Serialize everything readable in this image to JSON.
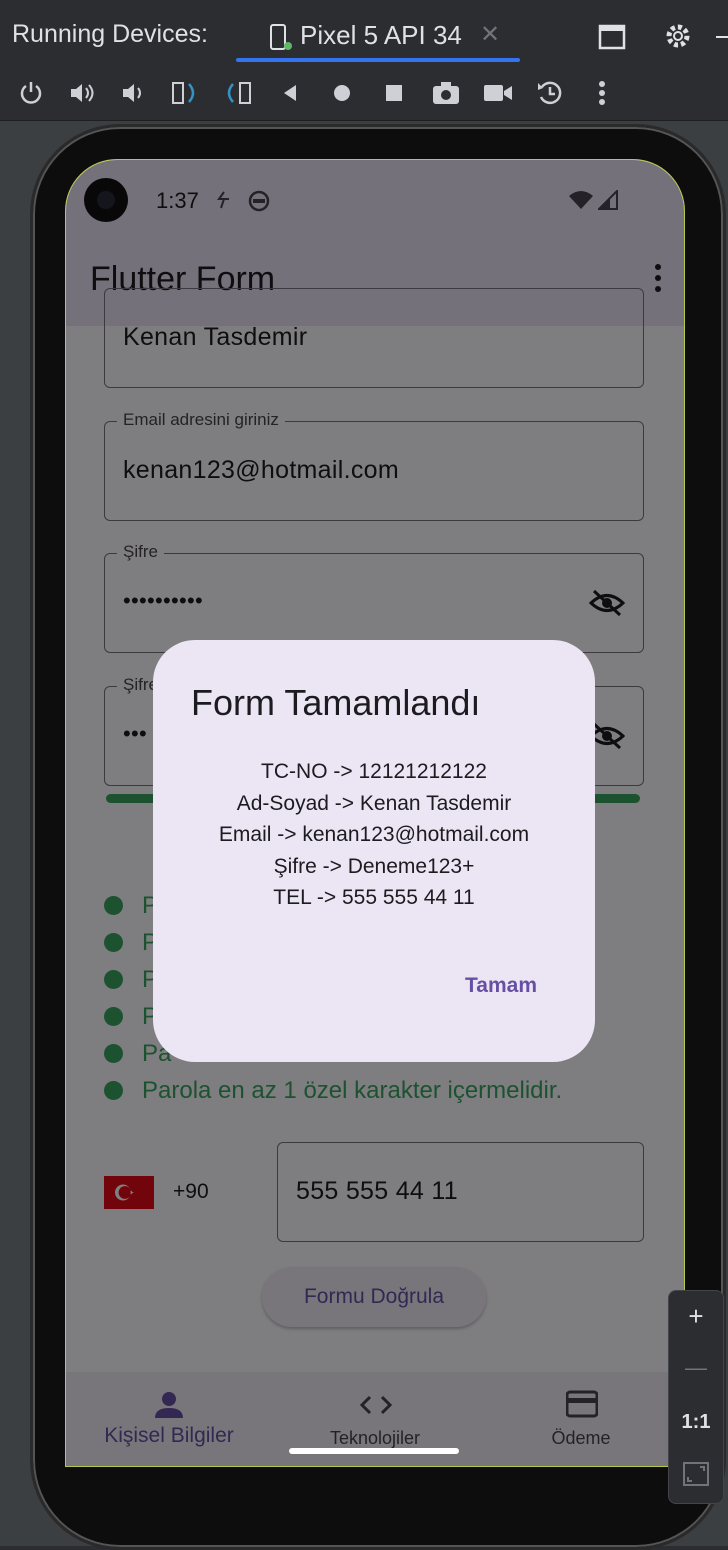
{
  "ide": {
    "panel_title": "Running Devices:",
    "device_tab": "Pixel 5 API 34",
    "toolbar_icons": [
      "power-icon",
      "volume-up-icon",
      "volume-down-icon",
      "rotate-left-icon",
      "rotate-right-icon",
      "back-icon",
      "home-icon",
      "overview-icon",
      "screenshot-icon",
      "screen-record-icon",
      "snapshot-icon",
      "more-icon"
    ],
    "zoom": {
      "plus": "+",
      "minus": "—",
      "one_to_one": "1:1"
    }
  },
  "status_bar": {
    "time": "1:37"
  },
  "app_bar": {
    "title": "Flutter Form"
  },
  "form": {
    "name_value": "Kenan Tasdemir",
    "email_label": "Email adresini giriniz",
    "email_value": "kenan123@hotmail.com",
    "password_label": "Şifre",
    "password_value": "••••••••••",
    "password_confirm_label": "Şifre",
    "password_confirm_value": "•••",
    "last_rule": "Parola en az 1 özel karakter içermelidir.",
    "rule_prefix_1": "P",
    "rule_prefix_2": "P",
    "rule_prefix_3": "P",
    "rule_prefix_4": "P",
    "rule_prefix_5": "Pa",
    "country_code": "+90",
    "phone_value": "555 555 44 11",
    "submit_label": "Formu Doğrula",
    "password_strength": 1.0
  },
  "bottom_nav": {
    "items": [
      {
        "label": "Kişisel Bilgiler",
        "active": true
      },
      {
        "label": "Teknolojiler",
        "active": false
      },
      {
        "label": "Ödeme",
        "active": false
      }
    ]
  },
  "dialog": {
    "title": "Form Tamamlandı",
    "lines": [
      "TC-NO -> 12121212122",
      "Ad-Soyad -> Kenan Tasdemir",
      "Email -> kenan123@hotmail.com",
      "Şifre -> Deneme123+",
      "TEL -> 555 555 44 11"
    ],
    "ok_label": "Tamam"
  },
  "colors": {
    "primary": "#6750a4",
    "success": "#3ba562",
    "appbar": "#ebe2f6",
    "dialog": "#ece6f4"
  }
}
